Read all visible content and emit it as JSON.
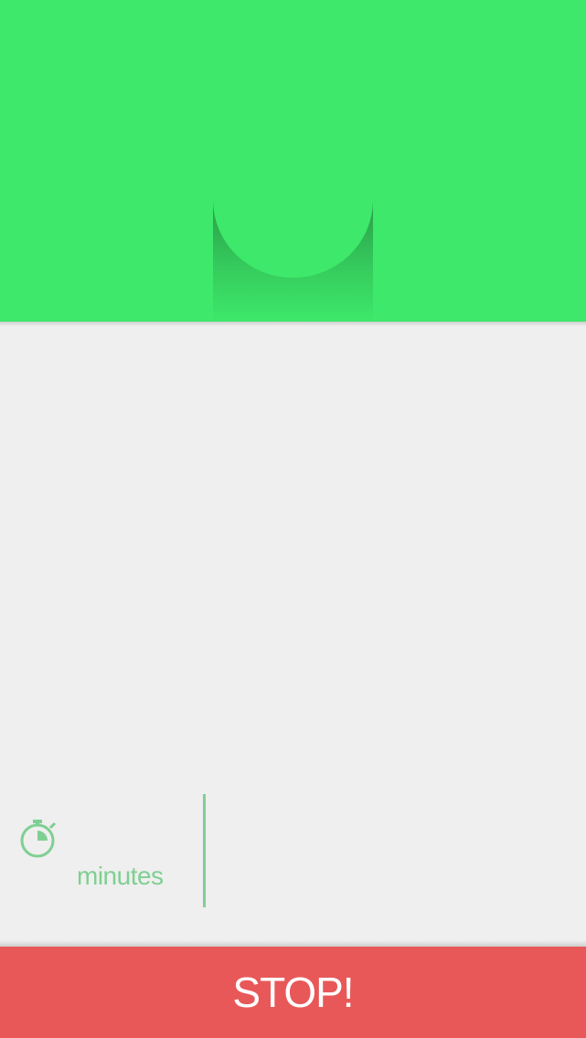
{
  "colors": {
    "header_green": "#3de86a",
    "background": "#efefef",
    "accent_green": "#7fcf92",
    "stop_red": "#e85858"
  },
  "stats": {
    "timer_icon": "stopwatch-icon",
    "minutes_label": "minutes"
  },
  "stop_button": {
    "label": "STOP!"
  }
}
